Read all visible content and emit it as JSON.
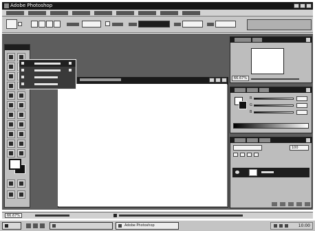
{
  "window": {
    "title": "Adobe Photoshop"
  },
  "icons": {
    "app": "photoshop-icon",
    "minimize": "minimize-icon",
    "maximize": "maximize-icon",
    "close": "close-icon",
    "tool_preset": "marquee-tool-preset-icon",
    "dropdown": "chevron-down-icon",
    "start": "windows-logo-icon",
    "eye": "eye-icon"
  },
  "menus": [],
  "options": {},
  "tool_flyout": {
    "items": []
  },
  "document": {
    "title": ""
  },
  "navigator": {
    "zoom": "66.67%"
  },
  "color_palette": {
    "sliders": [
      {
        "channel": "R",
        "value": ""
      },
      {
        "channel": "G",
        "value": ""
      },
      {
        "channel": "B",
        "value": ""
      }
    ]
  },
  "layers_palette": {
    "mode": "",
    "opacity": "100",
    "layers": [
      {
        "name": ""
      }
    ]
  },
  "status_bar": {
    "zoom": "66.67%",
    "message": ""
  },
  "taskbar": {
    "tasks": [
      {
        "label": ""
      },
      {
        "label": "Adobe Photoshop",
        "active": true
      }
    ],
    "clock": "10:00"
  },
  "colors": {
    "workspace": "#5d5d5d",
    "title_bar": "#161616",
    "canvas": "#ffffff",
    "panel": "#bdbdbd"
  }
}
